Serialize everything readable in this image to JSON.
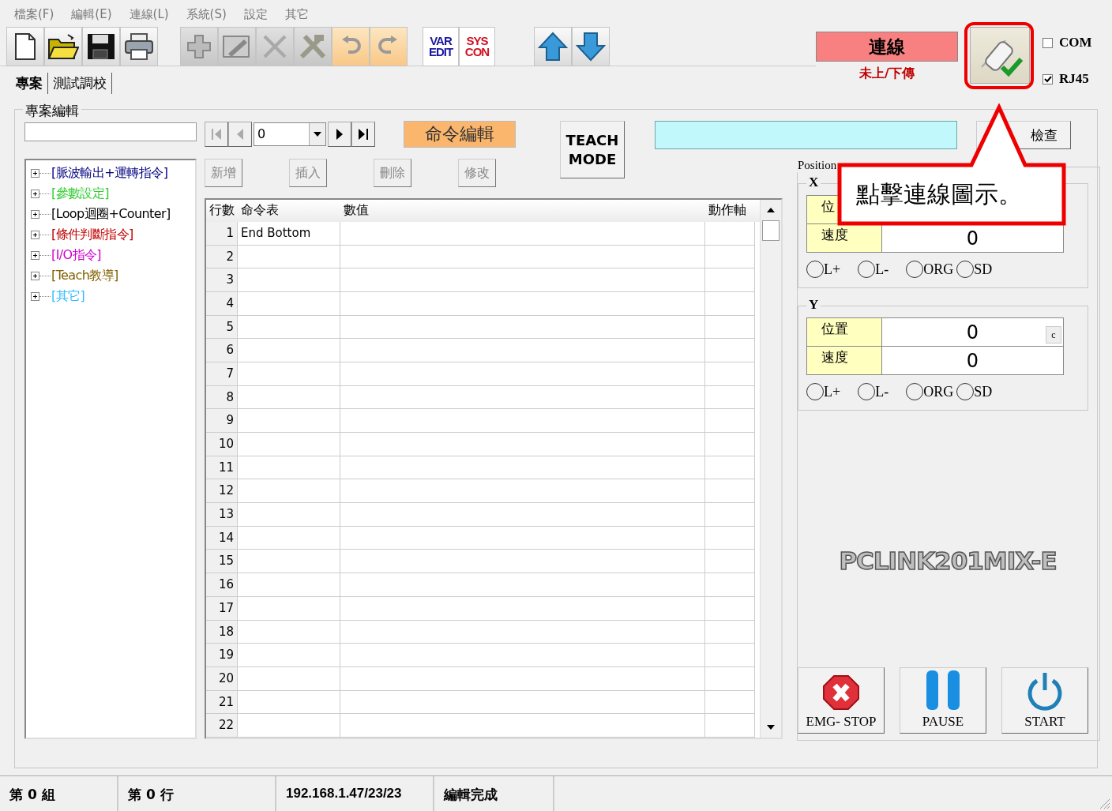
{
  "menu": [
    "檔案(F)",
    "編輯(E)",
    "連線(L)",
    "系統(S)",
    "設定",
    "其它"
  ],
  "toolbar": [
    [
      {
        "kind": "new",
        "disabled": false
      },
      {
        "kind": "open",
        "disabled": false
      },
      {
        "kind": "save",
        "disabled": false
      },
      {
        "kind": "print",
        "disabled": false
      }
    ],
    [
      {
        "kind": "add",
        "disabled": true
      },
      {
        "kind": "image-edit",
        "disabled": true
      },
      {
        "kind": "delete",
        "disabled": true
      },
      {
        "kind": "tools",
        "disabled": true
      },
      {
        "kind": "undo",
        "disabled": true
      },
      {
        "kind": "redo",
        "disabled": true
      }
    ],
    [
      {
        "kind": "text",
        "lines": [
          "VAR",
          "EDIT"
        ],
        "color": "#1a1aa0"
      },
      {
        "kind": "text",
        "lines": [
          "SYS",
          "CON"
        ],
        "color": "#d01020"
      }
    ],
    [
      {
        "kind": "up",
        "disabled": false
      },
      {
        "kind": "down",
        "disabled": false
      }
    ]
  ],
  "connection": {
    "status": "連線",
    "transfer": "未上/下傳",
    "options": [
      {
        "label": "COM",
        "checked": false
      },
      {
        "label": "RJ45",
        "checked": true
      }
    ]
  },
  "tabs": [
    {
      "label": "專案",
      "selected": true
    },
    {
      "label": "測試調校",
      "selected": false
    }
  ],
  "project": {
    "title": "專案編輯",
    "tree": [
      {
        "label": "[脈波輸出+運轉指令]",
        "color": "#000080"
      },
      {
        "label": "[參數設定]",
        "color": "#33cc33"
      },
      {
        "label": "[Loop迴圈+Counter]",
        "color": "#000000"
      },
      {
        "label": "[條件判斷指令]",
        "color": "#c00000"
      },
      {
        "label": "[I/O指令]",
        "color": "#cc00cc"
      },
      {
        "label": "[Teach教導]",
        "color": "#806000"
      },
      {
        "label": "[其它]",
        "color": "#33bbff"
      }
    ],
    "nav": {
      "value": "0",
      "buttons": [
        {
          "kind": "first",
          "disabled": true
        },
        {
          "kind": "prev",
          "disabled": true
        },
        {
          "kind": "next",
          "disabled": false
        },
        {
          "kind": "last",
          "disabled": false
        }
      ]
    },
    "command_edit": "命令編輯",
    "teach_mode": [
      "TEACH",
      "MODE"
    ],
    "check_button": "檢查",
    "actions": [
      {
        "label": "新增",
        "disabled": true
      },
      {
        "label": "插入",
        "disabled": true
      },
      {
        "label": "刪除",
        "disabled": true
      },
      {
        "label": "修改",
        "disabled": true
      }
    ],
    "table": {
      "columns": [
        "行數",
        "命令表",
        "數值",
        "動作軸"
      ],
      "rows": [
        {
          "line": "1",
          "command": "End Bottom"
        },
        {
          "line": "2"
        },
        {
          "line": "3"
        },
        {
          "line": "4"
        },
        {
          "line": "5"
        },
        {
          "line": "6"
        },
        {
          "line": "7"
        },
        {
          "line": "8"
        },
        {
          "line": "9"
        },
        {
          "line": "10"
        },
        {
          "line": "11"
        },
        {
          "line": "12"
        },
        {
          "line": "13"
        },
        {
          "line": "14"
        },
        {
          "line": "15"
        },
        {
          "line": "16"
        },
        {
          "line": "17"
        },
        {
          "line": "18"
        },
        {
          "line": "19"
        },
        {
          "line": "20"
        },
        {
          "line": "21"
        },
        {
          "line": "22"
        }
      ]
    }
  },
  "position": {
    "title": "Position",
    "axes": [
      {
        "name": "X",
        "rows": [
          {
            "label": "位"
          },
          {
            "label": "速度",
            "value": "0"
          }
        ],
        "signals": [
          {
            "label": "L+",
            "on": false
          },
          {
            "label": "L-",
            "on": false
          },
          {
            "label": "ORG",
            "on": false
          },
          {
            "label": "SD",
            "on": false
          }
        ]
      },
      {
        "name": "Y",
        "rows": [
          {
            "label": "位置",
            "value": "0",
            "clear": "c"
          },
          {
            "label": "速度",
            "value": "0"
          }
        ],
        "signals": [
          {
            "label": "L+",
            "on": false
          },
          {
            "label": "L-",
            "on": false
          },
          {
            "label": "ORG",
            "on": false
          },
          {
            "label": "SD",
            "on": false
          }
        ]
      }
    ],
    "logo": "PCLINK201MIX-E",
    "run_buttons": [
      {
        "kind": "stop",
        "label": "EMG- STOP"
      },
      {
        "kind": "pause",
        "label": "PAUSE"
      },
      {
        "kind": "start",
        "label": "START"
      }
    ]
  },
  "status_bar": [
    "第 0 組",
    "第 0 行",
    "192.168.1.47/23/23",
    "編輯完成"
  ],
  "callout": {
    "text": "點擊連線圖示。"
  }
}
